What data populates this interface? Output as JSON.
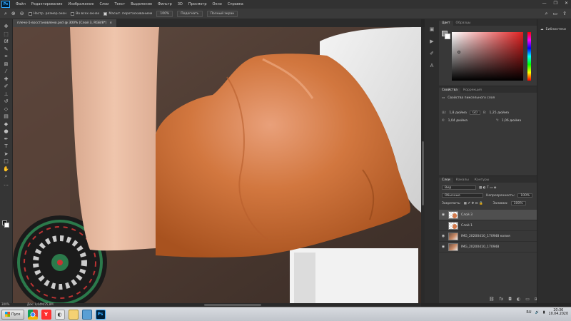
{
  "menu": {
    "logo": "Ps",
    "items": [
      "Файл",
      "Редактирование",
      "Изображение",
      "Слои",
      "Текст",
      "Выделение",
      "Фильтр",
      "3D",
      "Просмотр",
      "Окно",
      "Справка"
    ],
    "window_controls": [
      "—",
      "❐",
      "✕"
    ]
  },
  "options": {
    "fit_screen_label": "Настр. размер окон",
    "all_windows_label": "Во всех окнах",
    "scrubby_label": "Масшт. перетаскиванием",
    "zoom_btn": "100%",
    "fit_btn": "Подогнать",
    "fill_btn": "Полный экран"
  },
  "document": {
    "tab_title": "плечо-1-восстановлено.psd @ 300% (Слой 3, RGB/8*)",
    "zoom_status": "300%",
    "doc_status": "Док: 9,64M/25,8M"
  },
  "color_panel": {
    "tabs": [
      "Цвет",
      "Образцы"
    ],
    "fg_color": "#8a8a8a",
    "bg_color": "#ffffff"
  },
  "properties": {
    "tabs": [
      "Свойства",
      "Коррекция"
    ],
    "subtitle": "Свойства пиксельного слоя",
    "w_label": "Ш:",
    "w_value": "1,8 дюйма",
    "h_label": "В:",
    "h_value": "1,25 дюйма",
    "x_label": "X:",
    "x_value": "1,04 дюйма",
    "y_label": "Y:",
    "y_value": "1,06 дюйма",
    "link_label": "GO"
  },
  "layers_panel": {
    "tabs": [
      "Слои",
      "Каналы",
      "Контуры"
    ],
    "filter_label": "Вид",
    "blend_mode": "Обычные",
    "opacity_label": "Непрозрачность:",
    "opacity_value": "100%",
    "lock_label": "Закрепить:",
    "fill_label": "Заливка:",
    "fill_value": "100%",
    "layers": [
      {
        "name": "Слой 3",
        "selected": true,
        "visible": true,
        "thumb": "check"
      },
      {
        "name": "Слой 1",
        "selected": false,
        "visible": false,
        "thumb": "check"
      },
      {
        "name": "IMG_20200410_170948 копия",
        "selected": false,
        "visible": true,
        "thumb": "photo"
      },
      {
        "name": "IMG_20200410_170948",
        "selected": false,
        "visible": true,
        "thumb": "photo"
      }
    ]
  },
  "libraries": {
    "label": "Библиотеки"
  },
  "taskbar": {
    "start_label": "Пуск",
    "apps": [
      "chrome",
      "yandex",
      "browser",
      "explorer",
      "photos",
      "photoshop"
    ],
    "clock_time": "20:36",
    "clock_date": "10.04.2020"
  },
  "tools": [
    "move-icon",
    "marquee-icon",
    "lasso-icon",
    "quick-select-icon",
    "crop-icon",
    "frame-icon",
    "eyedropper-icon",
    "healing-icon",
    "brush-icon",
    "stamp-icon",
    "history-brush-icon",
    "eraser-icon",
    "gradient-icon",
    "blur-icon",
    "dodge-icon",
    "pen-icon",
    "type-icon",
    "path-select-icon",
    "rectangle-icon",
    "hand-icon",
    "zoom-icon",
    "more-icon"
  ]
}
